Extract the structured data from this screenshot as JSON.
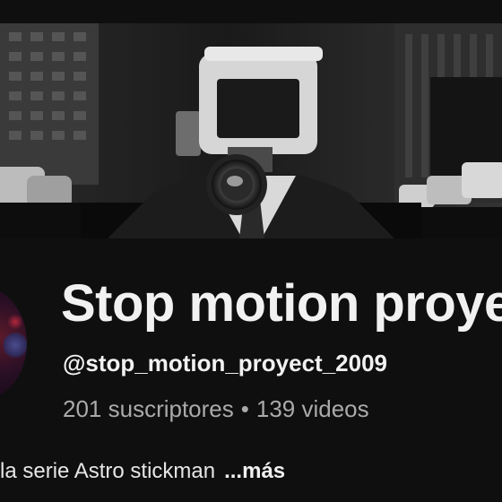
{
  "channel": {
    "title": "Stop motion proyect",
    "handle": "@stop_motion_proyect_2009",
    "subscribers": "201 suscriptores",
    "separator": "•",
    "videos": "139 videos",
    "description_snippet": "la serie Astro stickman",
    "more_label": "...más"
  },
  "banner": {
    "icon": "cameraman-banner-image"
  },
  "avatar": {
    "icon": "channel-avatar"
  },
  "colors": {
    "background": "#0f0f0f",
    "text_primary": "#f1f1f1",
    "text_secondary": "#aaaaaa"
  }
}
